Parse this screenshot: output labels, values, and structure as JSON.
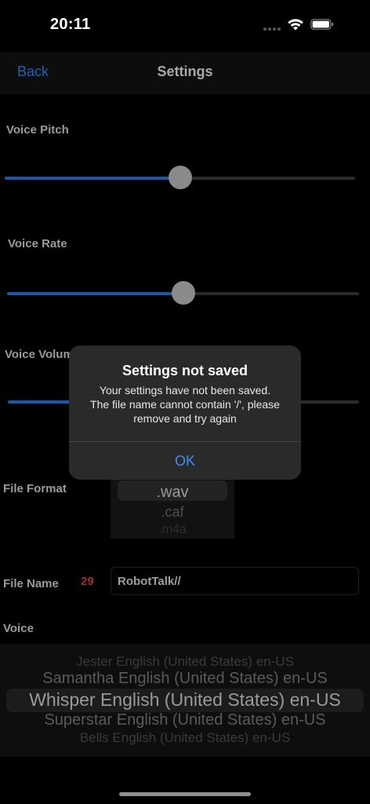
{
  "status_bar": {
    "time": "20:11"
  },
  "nav": {
    "back_label": "Back",
    "title": "Settings"
  },
  "settings": {
    "voice_pitch": {
      "label": "Voice Pitch",
      "value_fraction": 0.5
    },
    "voice_rate": {
      "label": "Voice Rate",
      "value_fraction": 0.5
    },
    "voice_volume": {
      "label": "Voice Volume",
      "value_fraction": 0.5
    },
    "file_format": {
      "label": "File Format",
      "options": [
        ".wav",
        ".caf",
        ".m4a"
      ],
      "selected": ".wav"
    },
    "file_name": {
      "label": "File Name",
      "char_count": "29",
      "value": "RobotTalk//"
    },
    "voice": {
      "label": "Voice",
      "options": [
        "Jester English (United States) en-US",
        "Samantha English (United States) en-US",
        "Whisper English (United States) en-US",
        "Superstar English (United States) en-US",
        "Bells English (United States) en-US"
      ],
      "selected": "Whisper English (United States) en-US"
    }
  },
  "alert": {
    "title": "Settings not saved",
    "message_lines": [
      "Your settings have not been saved.",
      "The file name cannot contain '/', please",
      "remove and try again"
    ],
    "ok_label": "OK"
  },
  "colors": {
    "accent": "#3d8ef5",
    "nav_back": "#1d63b3",
    "slider_fill": "#1d56a6",
    "error_count": "#9e2f2c"
  }
}
